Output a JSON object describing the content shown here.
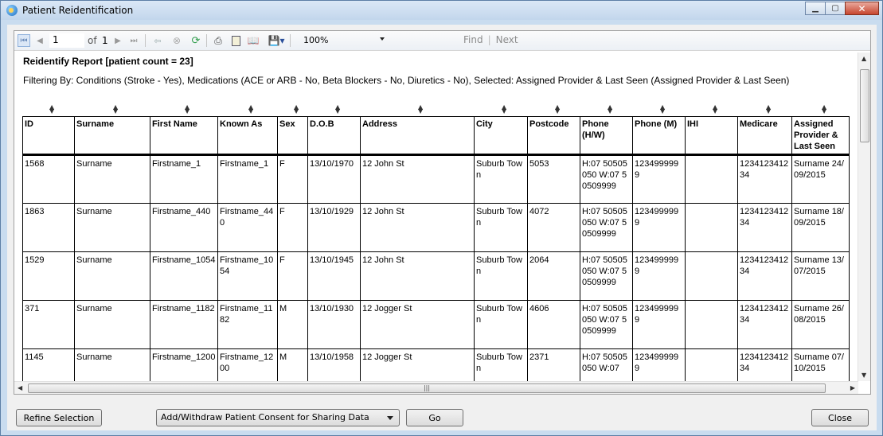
{
  "window": {
    "title": "Patient Reidentification"
  },
  "toolbar": {
    "page_value": "1",
    "of_label": "of",
    "page_total": "1",
    "zoom_value": "100%",
    "find_label": "Find",
    "next_label": "Next"
  },
  "report": {
    "title": "Reidentify Report  [patient count = 23]",
    "filter": "Filtering By: Conditions (Stroke - Yes), Medications (ACE or ARB - No, Beta Blockers - No, Diuretics - No), Selected: Assigned Provider & Last Seen (Assigned Provider & Last Seen)",
    "columns": [
      "ID",
      "Surname",
      "First Name",
      "Known As",
      "Sex",
      "D.O.B",
      "Address",
      "City",
      "Postcode",
      "Phone (H/W)",
      "Phone (M)",
      "IHI",
      "Medicare",
      "Assigned Provider & Last Seen"
    ],
    "rows": [
      [
        "1568",
        "Surname",
        "Firstname_1",
        "Firstname_1",
        "F",
        "13/10/1970",
        "12 John St",
        "Suburb Town",
        "5053",
        "H:07 50505050 W:07 50509999",
        "1234999999",
        "",
        "123412341234",
        "Surname 24/09/2015"
      ],
      [
        "1863",
        "Surname",
        "Firstname_440",
        "Firstname_440",
        "F",
        "13/10/1929",
        "12 John St",
        "Suburb Town",
        "4072",
        "H:07 50505050 W:07 50509999",
        "1234999999",
        "",
        "123412341234",
        "Surname 18/09/2015"
      ],
      [
        "1529",
        "Surname",
        "Firstname_1054",
        "Firstname_1054",
        "F",
        "13/10/1945",
        "12 John St",
        "Suburb Town",
        "2064",
        "H:07 50505050 W:07 50509999",
        "1234999999",
        "",
        "123412341234",
        "Surname 13/07/2015"
      ],
      [
        "371",
        "Surname",
        "Firstname_1182",
        "Firstname_1182",
        "M",
        "13/10/1930",
        "12 Jogger St",
        "Suburb Town",
        "4606",
        "H:07 50505050 W:07 50509999",
        "1234999999",
        "",
        "123412341234",
        "Surname 26/08/2015"
      ],
      [
        "1145",
        "Surname",
        "Firstname_1200",
        "Firstname_1200",
        "M",
        "13/10/1958",
        "12 Jogger St",
        "Suburb Town",
        "2371",
        "H:07 50505050 W:07",
        "1234999999",
        "",
        "123412341234",
        "Surname 07/10/2015"
      ]
    ]
  },
  "footer": {
    "refine_label": "Refine Selection",
    "consent_option": "Add/Withdraw Patient Consent for Sharing Data",
    "go_label": "Go",
    "close_label": "Close"
  }
}
